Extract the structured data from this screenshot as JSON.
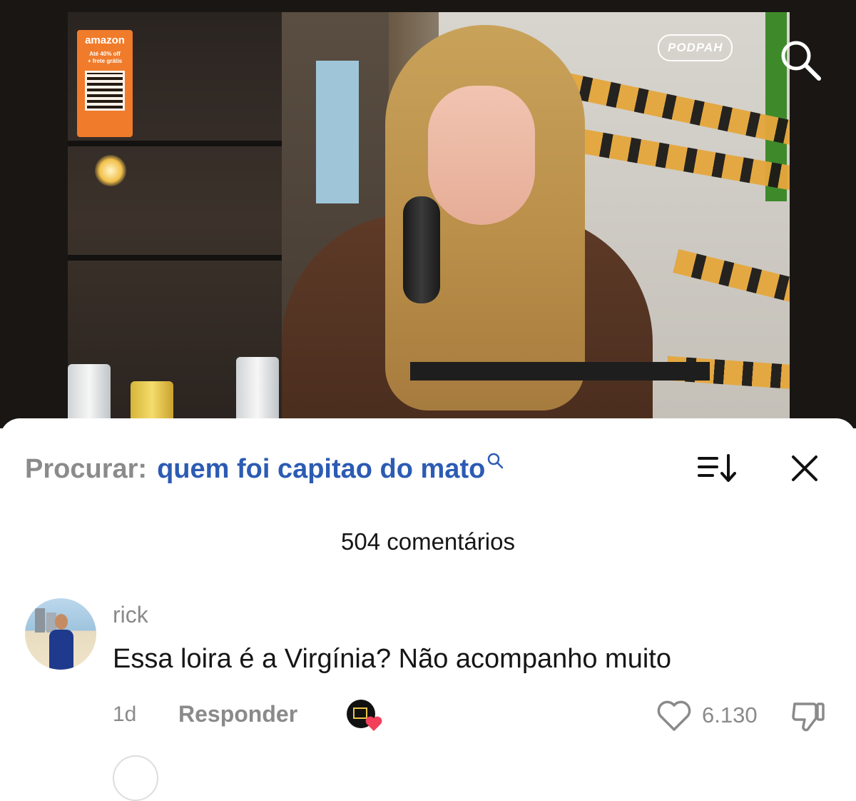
{
  "video": {
    "brand_logo": "PODPAH",
    "promo": {
      "brand": "amazon",
      "note": "Até 40% off\n+ frete grátis"
    },
    "search_icon": "search-icon"
  },
  "comments": {
    "search": {
      "prefix": "Procurar:",
      "query": "quem foi capitao do mato"
    },
    "count_label": "504 comentários",
    "items": [
      {
        "username": "rick",
        "text": "Essa loira é a Virgínia? Não acompanho muito",
        "time": "1d",
        "reply_label": "Responder",
        "like_count": "6.130"
      }
    ]
  },
  "colors": {
    "accent_blue": "#2c5bb3",
    "muted_gray": "#8a8a8a",
    "like_badge_red": "#f2405a"
  }
}
